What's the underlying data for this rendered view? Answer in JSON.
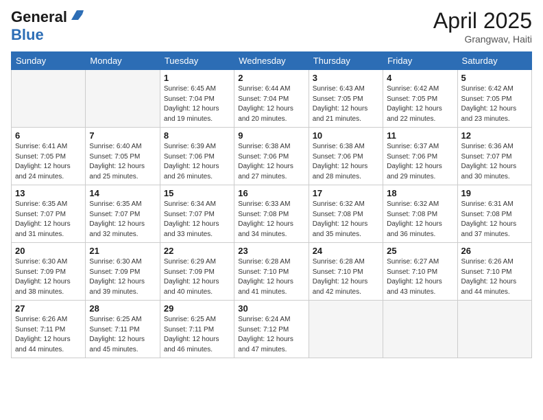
{
  "header": {
    "logo_line1": "General",
    "logo_line2": "Blue",
    "month_title": "April 2025",
    "subtitle": "Grangwav, Haiti"
  },
  "weekdays": [
    "Sunday",
    "Monday",
    "Tuesday",
    "Wednesday",
    "Thursday",
    "Friday",
    "Saturday"
  ],
  "weeks": [
    [
      {
        "day": "",
        "info": ""
      },
      {
        "day": "",
        "info": ""
      },
      {
        "day": "1",
        "info": "Sunrise: 6:45 AM\nSunset: 7:04 PM\nDaylight: 12 hours and 19 minutes."
      },
      {
        "day": "2",
        "info": "Sunrise: 6:44 AM\nSunset: 7:04 PM\nDaylight: 12 hours and 20 minutes."
      },
      {
        "day": "3",
        "info": "Sunrise: 6:43 AM\nSunset: 7:05 PM\nDaylight: 12 hours and 21 minutes."
      },
      {
        "day": "4",
        "info": "Sunrise: 6:42 AM\nSunset: 7:05 PM\nDaylight: 12 hours and 22 minutes."
      },
      {
        "day": "5",
        "info": "Sunrise: 6:42 AM\nSunset: 7:05 PM\nDaylight: 12 hours and 23 minutes."
      }
    ],
    [
      {
        "day": "6",
        "info": "Sunrise: 6:41 AM\nSunset: 7:05 PM\nDaylight: 12 hours and 24 minutes."
      },
      {
        "day": "7",
        "info": "Sunrise: 6:40 AM\nSunset: 7:05 PM\nDaylight: 12 hours and 25 minutes."
      },
      {
        "day": "8",
        "info": "Sunrise: 6:39 AM\nSunset: 7:06 PM\nDaylight: 12 hours and 26 minutes."
      },
      {
        "day": "9",
        "info": "Sunrise: 6:38 AM\nSunset: 7:06 PM\nDaylight: 12 hours and 27 minutes."
      },
      {
        "day": "10",
        "info": "Sunrise: 6:38 AM\nSunset: 7:06 PM\nDaylight: 12 hours and 28 minutes."
      },
      {
        "day": "11",
        "info": "Sunrise: 6:37 AM\nSunset: 7:06 PM\nDaylight: 12 hours and 29 minutes."
      },
      {
        "day": "12",
        "info": "Sunrise: 6:36 AM\nSunset: 7:07 PM\nDaylight: 12 hours and 30 minutes."
      }
    ],
    [
      {
        "day": "13",
        "info": "Sunrise: 6:35 AM\nSunset: 7:07 PM\nDaylight: 12 hours and 31 minutes."
      },
      {
        "day": "14",
        "info": "Sunrise: 6:35 AM\nSunset: 7:07 PM\nDaylight: 12 hours and 32 minutes."
      },
      {
        "day": "15",
        "info": "Sunrise: 6:34 AM\nSunset: 7:07 PM\nDaylight: 12 hours and 33 minutes."
      },
      {
        "day": "16",
        "info": "Sunrise: 6:33 AM\nSunset: 7:08 PM\nDaylight: 12 hours and 34 minutes."
      },
      {
        "day": "17",
        "info": "Sunrise: 6:32 AM\nSunset: 7:08 PM\nDaylight: 12 hours and 35 minutes."
      },
      {
        "day": "18",
        "info": "Sunrise: 6:32 AM\nSunset: 7:08 PM\nDaylight: 12 hours and 36 minutes."
      },
      {
        "day": "19",
        "info": "Sunrise: 6:31 AM\nSunset: 7:08 PM\nDaylight: 12 hours and 37 minutes."
      }
    ],
    [
      {
        "day": "20",
        "info": "Sunrise: 6:30 AM\nSunset: 7:09 PM\nDaylight: 12 hours and 38 minutes."
      },
      {
        "day": "21",
        "info": "Sunrise: 6:30 AM\nSunset: 7:09 PM\nDaylight: 12 hours and 39 minutes."
      },
      {
        "day": "22",
        "info": "Sunrise: 6:29 AM\nSunset: 7:09 PM\nDaylight: 12 hours and 40 minutes."
      },
      {
        "day": "23",
        "info": "Sunrise: 6:28 AM\nSunset: 7:10 PM\nDaylight: 12 hours and 41 minutes."
      },
      {
        "day": "24",
        "info": "Sunrise: 6:28 AM\nSunset: 7:10 PM\nDaylight: 12 hours and 42 minutes."
      },
      {
        "day": "25",
        "info": "Sunrise: 6:27 AM\nSunset: 7:10 PM\nDaylight: 12 hours and 43 minutes."
      },
      {
        "day": "26",
        "info": "Sunrise: 6:26 AM\nSunset: 7:10 PM\nDaylight: 12 hours and 44 minutes."
      }
    ],
    [
      {
        "day": "27",
        "info": "Sunrise: 6:26 AM\nSunset: 7:11 PM\nDaylight: 12 hours and 44 minutes."
      },
      {
        "day": "28",
        "info": "Sunrise: 6:25 AM\nSunset: 7:11 PM\nDaylight: 12 hours and 45 minutes."
      },
      {
        "day": "29",
        "info": "Sunrise: 6:25 AM\nSunset: 7:11 PM\nDaylight: 12 hours and 46 minutes."
      },
      {
        "day": "30",
        "info": "Sunrise: 6:24 AM\nSunset: 7:12 PM\nDaylight: 12 hours and 47 minutes."
      },
      {
        "day": "",
        "info": ""
      },
      {
        "day": "",
        "info": ""
      },
      {
        "day": "",
        "info": ""
      }
    ]
  ]
}
